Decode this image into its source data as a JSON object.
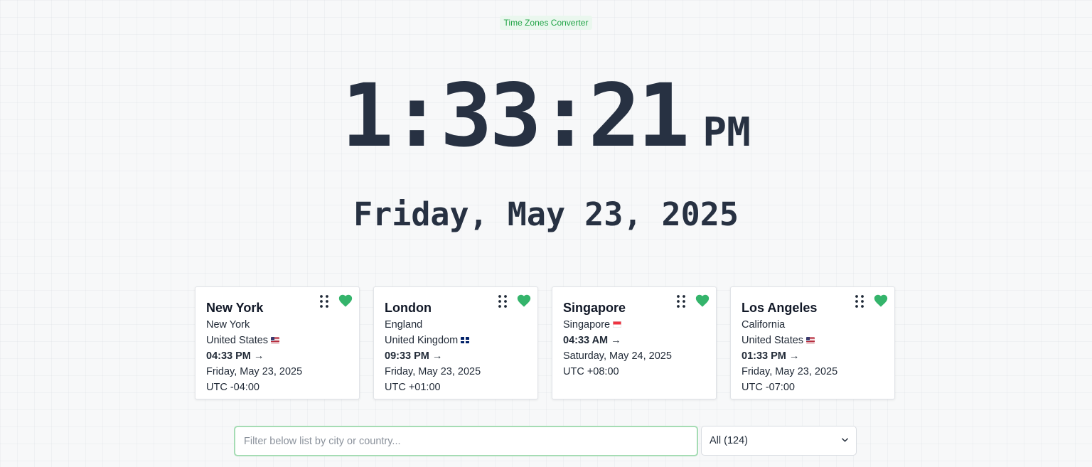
{
  "app": {
    "title": "Time Zones Converter"
  },
  "clock": {
    "time": "1:33:21",
    "ampm": "PM",
    "date": "Friday, May 23, 2025"
  },
  "favorites": [
    {
      "city": "New York",
      "region": "New York",
      "country": "United States",
      "flag": "us",
      "time": "04:33 PM",
      "arrow": "→",
      "date": "Friday, May 23, 2025",
      "utc": "UTC -04:00"
    },
    {
      "city": "London",
      "region": "England",
      "country": "United Kingdom",
      "flag": "gb",
      "time": "09:33 PM",
      "arrow": "→",
      "date": "Friday, May 23, 2025",
      "utc": "UTC +01:00"
    },
    {
      "city": "Singapore",
      "region": "Singapore",
      "flag": "sg",
      "time": "04:33 AM",
      "arrow": "→",
      "date": "Saturday, May 24, 2025",
      "utc": "UTC +08:00"
    },
    {
      "city": "Los Angeles",
      "region": "California",
      "country": "United States",
      "flag": "us",
      "time": "01:33 PM",
      "arrow": "→",
      "date": "Friday, May 23, 2025",
      "utc": "UTC -07:00"
    }
  ],
  "filter": {
    "placeholder": "Filter below list by city or country...",
    "value": "",
    "select_value": "All (124)"
  },
  "colors": {
    "accent": "#22a447",
    "heart": "#34b46b",
    "text_dark": "#273142",
    "focus_border": "#a5dcb4"
  },
  "icons": {
    "drag": "drag-handle-icon",
    "favorite": "heart-icon",
    "dropdown": "chevron-down-icon"
  }
}
